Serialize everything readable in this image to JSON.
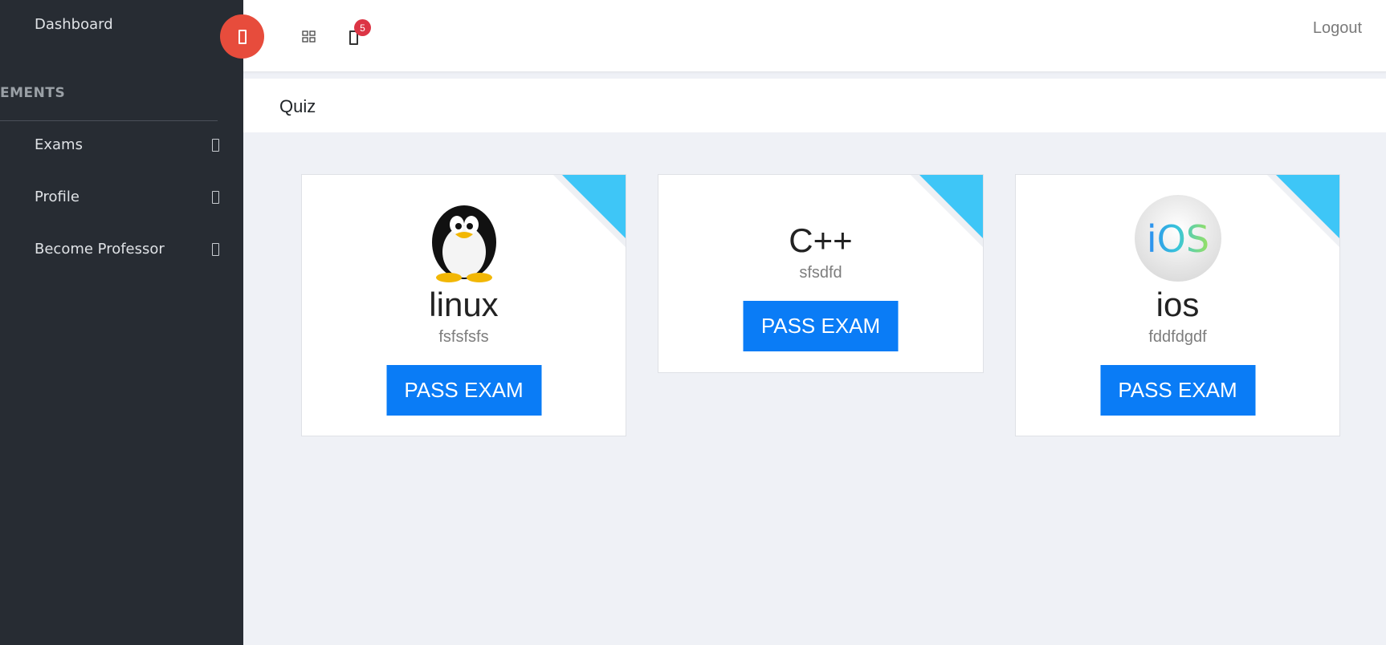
{
  "sidebar": {
    "dashboard_label": "Dashboard",
    "section_heading": "EMENTS",
    "items": [
      {
        "label": "Exams",
        "icon": "chevron-right-icon"
      },
      {
        "label": "Profile",
        "icon": "chevron-right-icon"
      },
      {
        "label": "Become Professor",
        "icon": "chevron-right-icon"
      }
    ]
  },
  "header": {
    "notification_count": "5",
    "logout_label": "Logout",
    "toggle_color": "#e74c3c"
  },
  "page": {
    "title": "Quiz"
  },
  "cards": [
    {
      "title": "linux",
      "subtitle": "fsfsfsfs",
      "button_label": "PASS EXAM",
      "image": "linux-penguin-icon"
    },
    {
      "title": "C++",
      "subtitle": "sfsdfd",
      "button_label": "PASS EXAM",
      "image": ""
    },
    {
      "title": "ios",
      "subtitle": "fddfdgdf",
      "button_label": "PASS EXAM",
      "image": "ios-logo-icon"
    }
  ],
  "colors": {
    "sidebar_bg": "#272c33",
    "accent_button": "#0a7cf6",
    "ribbon": "#3ec6f7"
  }
}
